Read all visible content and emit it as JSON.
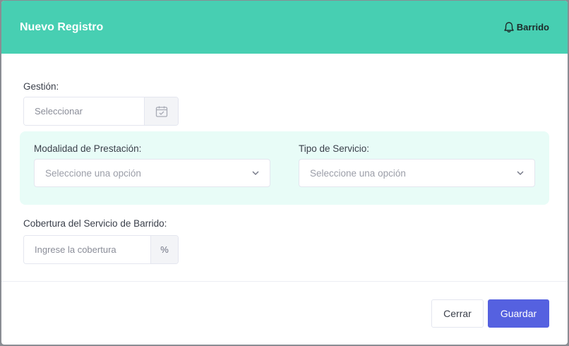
{
  "modal": {
    "title": "Nuevo Registro",
    "badge_label": "Barrido",
    "badge_icon": "bell-icon"
  },
  "form": {
    "gestion": {
      "label": "Gestión:",
      "placeholder": "Seleccionar",
      "icon": "calendar-icon"
    },
    "modalidad": {
      "label": "Modalidad de Prestación:",
      "selected": "Seleccione una opción"
    },
    "tipo_servicio": {
      "label": "Tipo de Servicio:",
      "selected": "Seleccione una opción"
    },
    "cobertura": {
      "label": "Cobertura del Servicio de Barrido:",
      "placeholder": "Ingrese la cobertura",
      "suffix": "%"
    }
  },
  "footer": {
    "cancel_label": "Cerrar",
    "save_label": "Guardar"
  },
  "colors": {
    "header": "#47cfb2",
    "panel": "#e8fcf7",
    "primary_button": "#5561e0"
  }
}
